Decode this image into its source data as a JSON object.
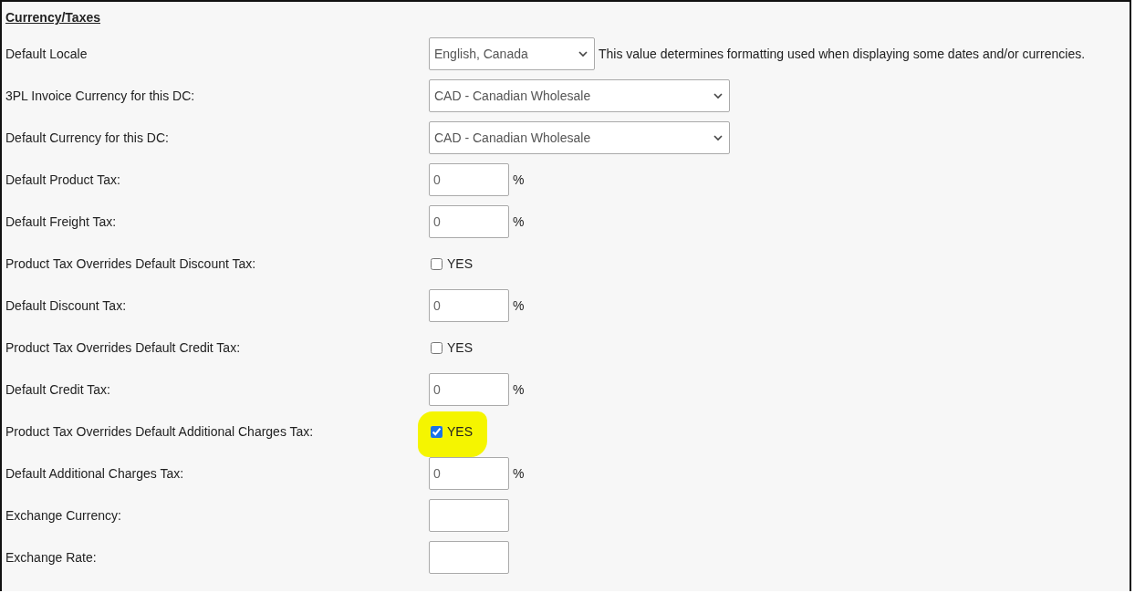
{
  "section": {
    "title": "Currency/Taxes"
  },
  "rows": [
    {
      "label": "Default Locale",
      "kind": "select",
      "value": "English, Canada",
      "wide": false,
      "note": "This value determines formatting used when displaying some dates and/or currencies."
    },
    {
      "label": "3PL Invoice Currency for this DC:",
      "kind": "select",
      "value": "CAD - Canadian Wholesale",
      "wide": true
    },
    {
      "label": "Default Currency for this DC:",
      "kind": "select",
      "value": "CAD - Canadian Wholesale",
      "wide": true
    },
    {
      "label": "Default Product Tax:",
      "kind": "percent",
      "value": "0",
      "unit": "%"
    },
    {
      "label": "Default Freight Tax:",
      "kind": "percent",
      "value": "0",
      "unit": "%"
    },
    {
      "label": "Product Tax Overrides Default Discount Tax:",
      "kind": "checkbox",
      "checked": false,
      "option": "YES",
      "highlighted": false
    },
    {
      "label": "Default Discount Tax:",
      "kind": "percent",
      "value": "0",
      "unit": "%"
    },
    {
      "label": "Product Tax Overrides Default Credit Tax:",
      "kind": "checkbox",
      "checked": false,
      "option": "YES",
      "highlighted": false
    },
    {
      "label": "Default Credit Tax:",
      "kind": "percent",
      "value": "0",
      "unit": "%"
    },
    {
      "label": "Product Tax Overrides Default Additional Charges Tax:",
      "kind": "checkbox",
      "checked": true,
      "option": "YES",
      "highlighted": true
    },
    {
      "label": "Default Additional Charges Tax:",
      "kind": "percent",
      "value": "0",
      "unit": "%"
    },
    {
      "label": "Exchange Currency:",
      "kind": "text",
      "value": ""
    },
    {
      "label": "Exchange Rate:",
      "kind": "text",
      "value": ""
    }
  ]
}
